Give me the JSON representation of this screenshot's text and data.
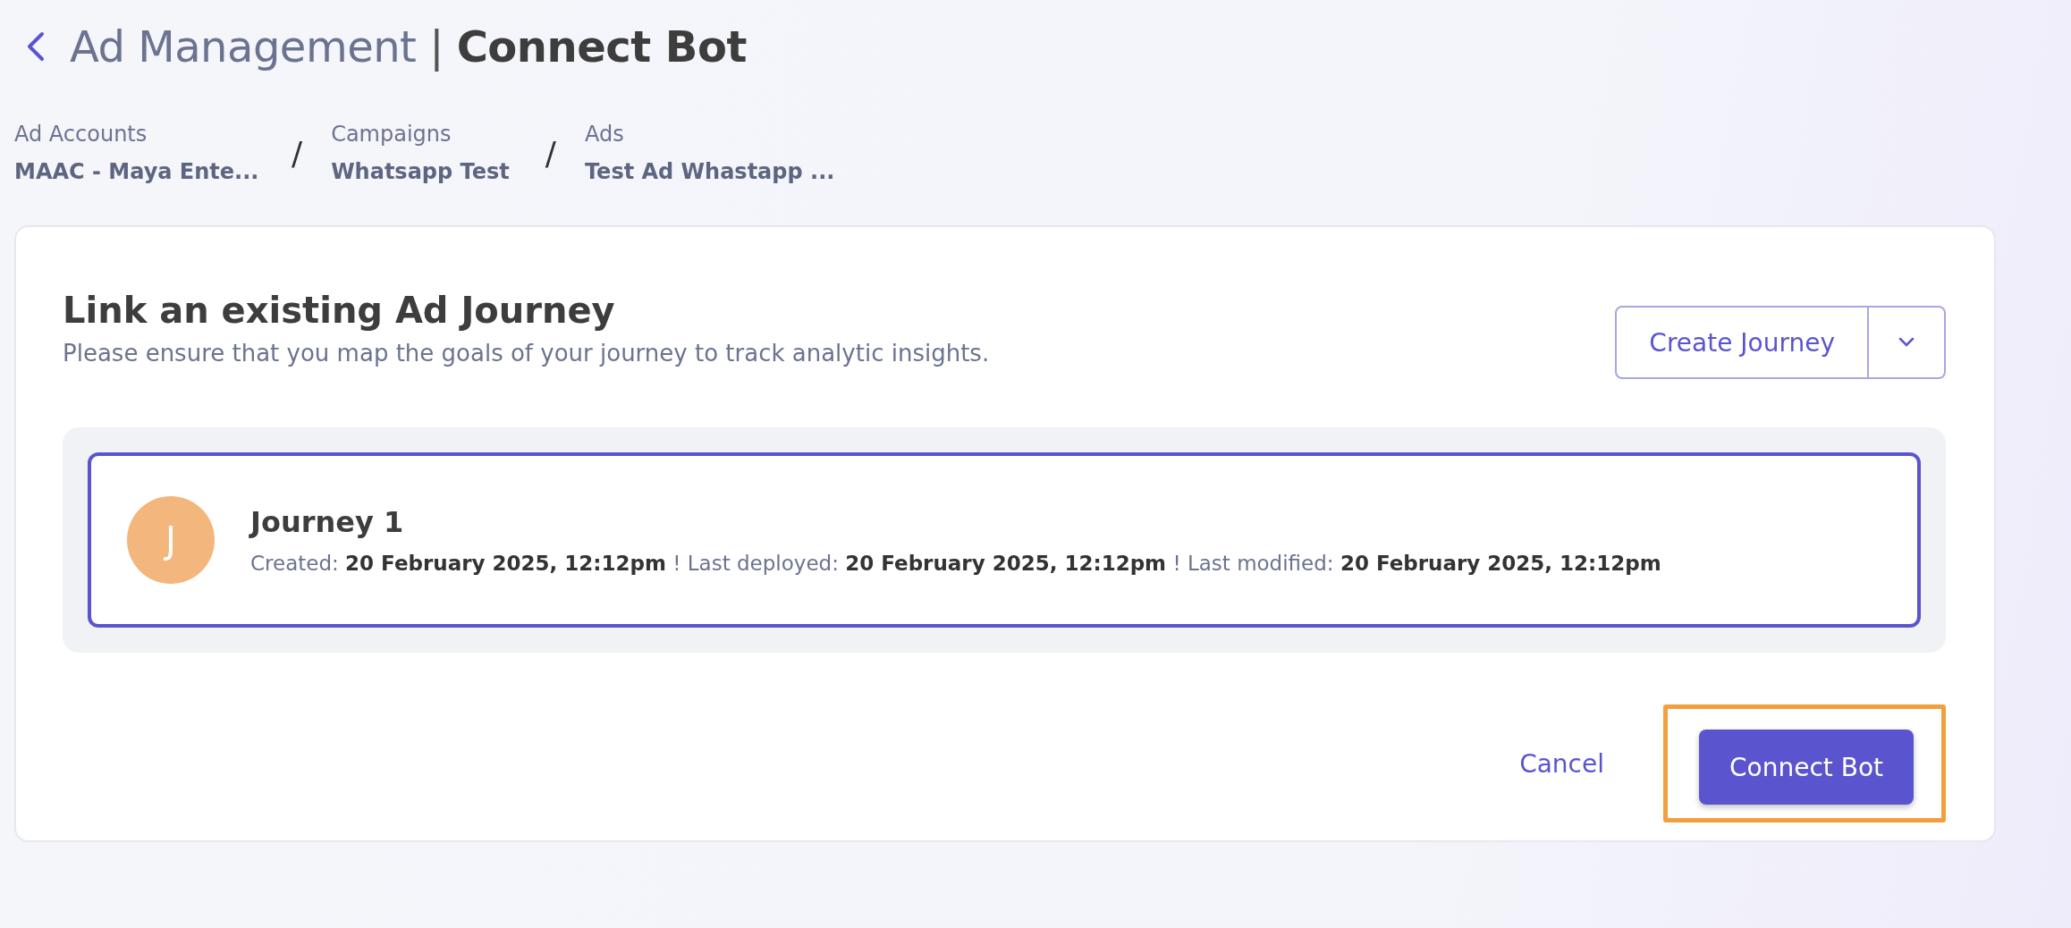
{
  "header": {
    "section": "Ad Management",
    "separator": "|",
    "page": "Connect Bot"
  },
  "breadcrumbs": [
    {
      "label": "Ad Accounts",
      "value": "MAAC - Maya Ente..."
    },
    {
      "label": "Campaigns",
      "value": "Whatsapp Test"
    },
    {
      "label": "Ads",
      "value": "Test Ad Whastapp ..."
    }
  ],
  "breadcrumb_separator": "/",
  "card": {
    "title": "Link an existing Ad Journey",
    "subtitle": "Please ensure that you map the goals of your journey to track analytic insights.",
    "create_button": "Create Journey",
    "journeys": [
      {
        "initial": "J",
        "color": "#f3b67d",
        "name": "Journey 1",
        "details": "Created: **20 February 2025, 12:12pm** ! Last deployed: **20 February 2025, 12:12pm** ! Last modified: **20 February 2025, 12:12pm**",
        "selected": true
      }
    ],
    "cancel": "Cancel",
    "connect": {
      "label": "Connect Bot",
      "highlighted": true
    }
  }
}
